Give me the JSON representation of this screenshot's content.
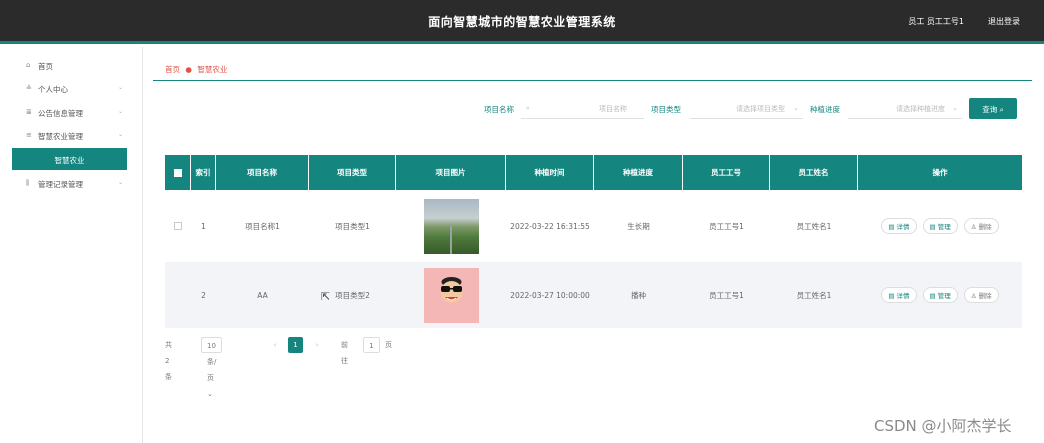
{
  "header": {
    "title": "面向智慧城市的智慧农业管理系统",
    "user": "员工 员工工号1",
    "logout": "退出登录"
  },
  "sidebar": {
    "items": [
      {
        "label": "首页",
        "icon": "home-icon",
        "glyph": "⌂",
        "chevron": ""
      },
      {
        "label": "个人中心",
        "icon": "user-icon",
        "glyph": "≗",
        "chevron": "⌄"
      },
      {
        "label": "公告信息管理",
        "icon": "notice-icon",
        "glyph": "≣",
        "chevron": "⌄"
      },
      {
        "label": "智慧农业管理",
        "icon": "list-icon",
        "glyph": "≡",
        "chevron": "⌄"
      },
      {
        "label": "管理记录管理",
        "icon": "chart-icon",
        "glyph": "⫼",
        "chevron": "⌄"
      }
    ],
    "active_sub": "智慧农业"
  },
  "breadcrumb": {
    "home": "首页",
    "separator": "●",
    "current": "智慧农业"
  },
  "filters": {
    "name_label": "项目名称",
    "name_placeholder": "项目名称",
    "type_label": "项目类型",
    "type_placeholder": "请选择项目类型",
    "progress_label": "种植进度",
    "progress_placeholder": "请选择种植进度",
    "search_button": "查询 ⌕"
  },
  "table": {
    "headers": [
      "",
      "索引",
      "项目名称",
      "项目类型",
      "项目图片",
      "种植时间",
      "种植进度",
      "员工工号",
      "员工姓名",
      "操作"
    ],
    "rows": [
      {
        "index": "1",
        "name": "项目名称1",
        "type": "项目类型1",
        "time": "2022-03-22 16:31:55",
        "progress": "生长期",
        "emp_no": "员工工号1",
        "emp_name": "员工姓名1"
      },
      {
        "index": "2",
        "name": "AA",
        "type": "项目类型2",
        "time": "2022-03-27 10:00:00",
        "progress": "播种",
        "emp_no": "员工工号1",
        "emp_name": "员工姓名1"
      }
    ],
    "actions": {
      "detail": "▤ 详情",
      "manage": "▤ 管理",
      "delete": "♙ 删除"
    }
  },
  "pager": {
    "total": "共 2 条",
    "page_size": "10条/页 ⌄",
    "prev": "‹",
    "current": "1",
    "next": "›",
    "goto_label": "前往",
    "goto_value": "1",
    "page_unit": "页"
  },
  "watermark": "CSDN @小阿杰学长",
  "colors": {
    "accent": "#14857f",
    "topbar": "#2b2b2b"
  }
}
